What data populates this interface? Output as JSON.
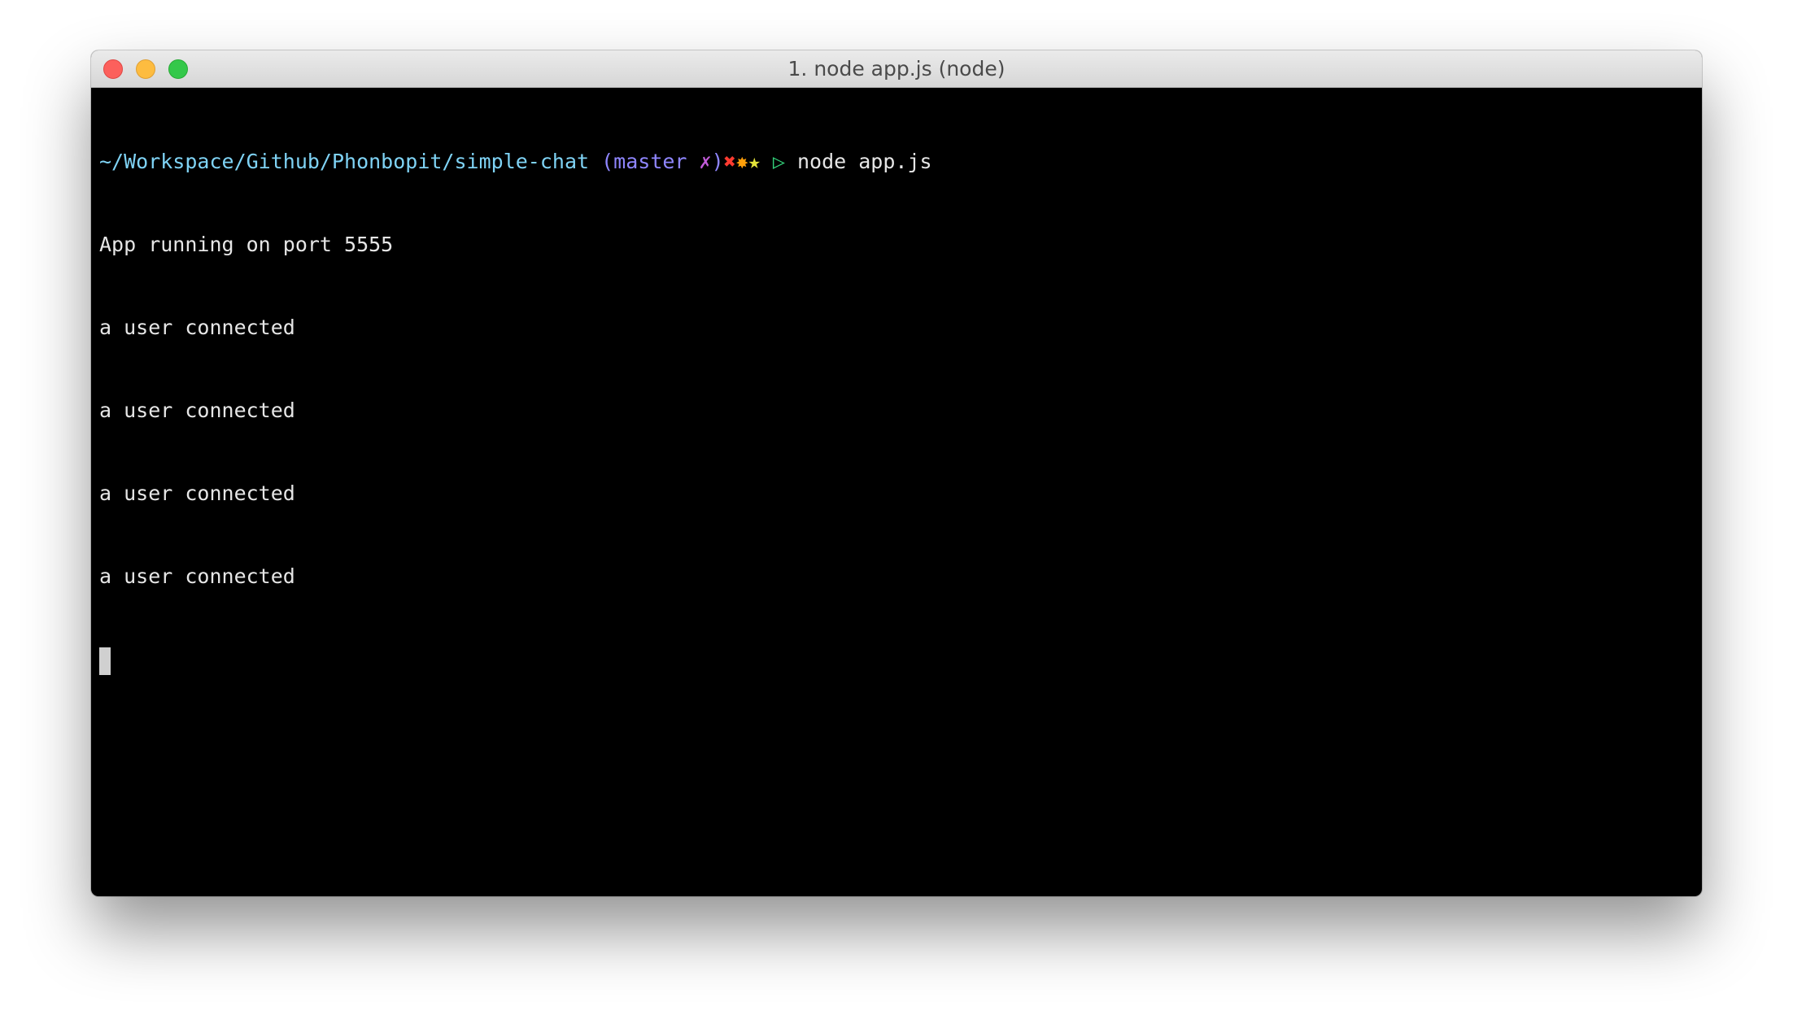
{
  "window": {
    "title": "1. node app.js (node)"
  },
  "prompt": {
    "path": "~/Workspace/Github/Phonbopit/simple-chat",
    "branch_open": " (master ",
    "dirty": "✗",
    "branch_close": ")",
    "star1": "✖",
    "star2": "✸",
    "star3": "★",
    "arrow": " ▷ ",
    "command": "node app.js"
  },
  "output": [
    "App running on port 5555",
    "a user connected",
    "a user connected",
    "a user connected",
    "a user connected"
  ],
  "colors": {
    "path": "#7fd3f5",
    "branch": "#8f86ff",
    "dirty": "#c25bd9",
    "arrow": "#33d17a",
    "background": "#000000"
  }
}
